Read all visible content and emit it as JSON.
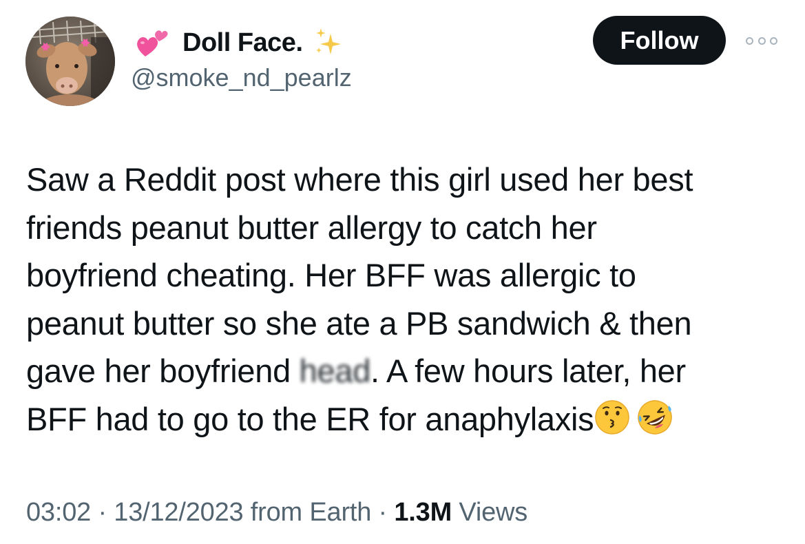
{
  "author": {
    "display_name": "Doll Face.",
    "handle": "@smoke_nd_pearlz",
    "name_prefix_icon": "two-hearts-icon",
    "name_suffix_icon": "sparkles-icon"
  },
  "actions": {
    "follow_label": "Follow",
    "more_icon": "more-options-icon"
  },
  "tweet": {
    "lines": [
      "Saw a Reddit post where this girl used her best",
      "friends peanut butter allergy to catch her",
      "boyfriend cheating. Her BFF was allergic to",
      "peanut butter so she ate a PB sandwich & then"
    ],
    "line5_before": "gave her boyfriend ",
    "line5_blurred": "head",
    "line5_after": ". A few hours later, her",
    "line6_text": "BFF had to go to the ER for anaphylaxis",
    "trailing_emojis": [
      "kissing-face-icon",
      "rolling-on-floor-laughing-icon"
    ]
  },
  "meta": {
    "time": "03:02",
    "sep1": " · ",
    "date": "13/12/2023",
    "source": " from Earth",
    "sep2": " · ",
    "views_count": "1.3M",
    "views_label": " Views"
  },
  "colors": {
    "text_primary": "#0f1419",
    "text_secondary": "#536471",
    "follow_bg": "#0f1419",
    "heart_pink": "#f0529c"
  }
}
